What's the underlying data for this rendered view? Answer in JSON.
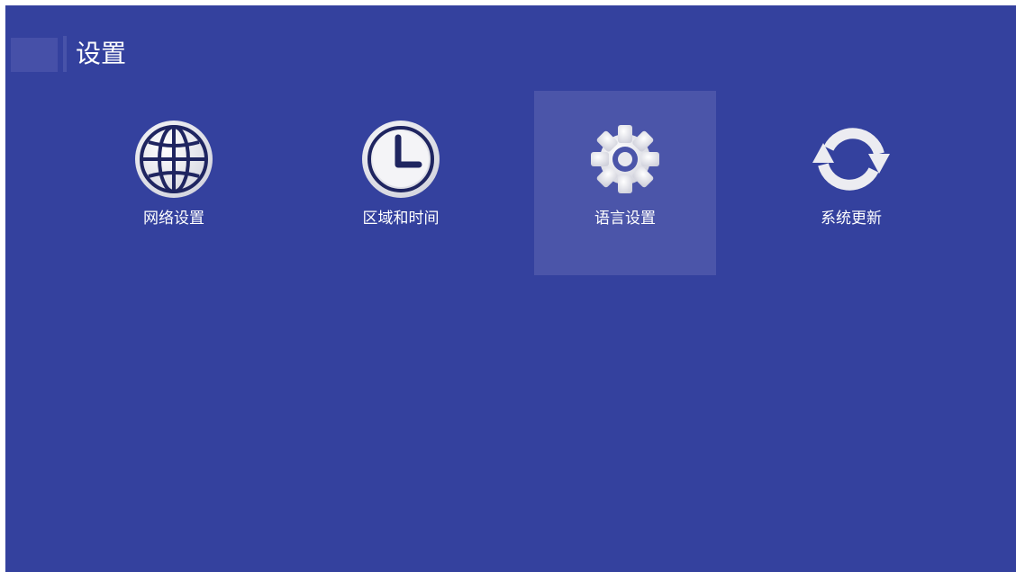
{
  "header": {
    "title": "设置"
  },
  "menu": {
    "items": [
      {
        "label": "网络设置",
        "icon": "globe-icon"
      },
      {
        "label": "区域和时间",
        "icon": "clock-icon"
      },
      {
        "label": "语言设置",
        "icon": "gear-icon",
        "selected": true
      },
      {
        "label": "系统更新",
        "icon": "refresh-icon"
      }
    ]
  },
  "colors": {
    "background": "#34419e",
    "selected_tile": "#4b55a9",
    "icon_fill": "#e9e9ee",
    "icon_detail": "#2a3270"
  }
}
